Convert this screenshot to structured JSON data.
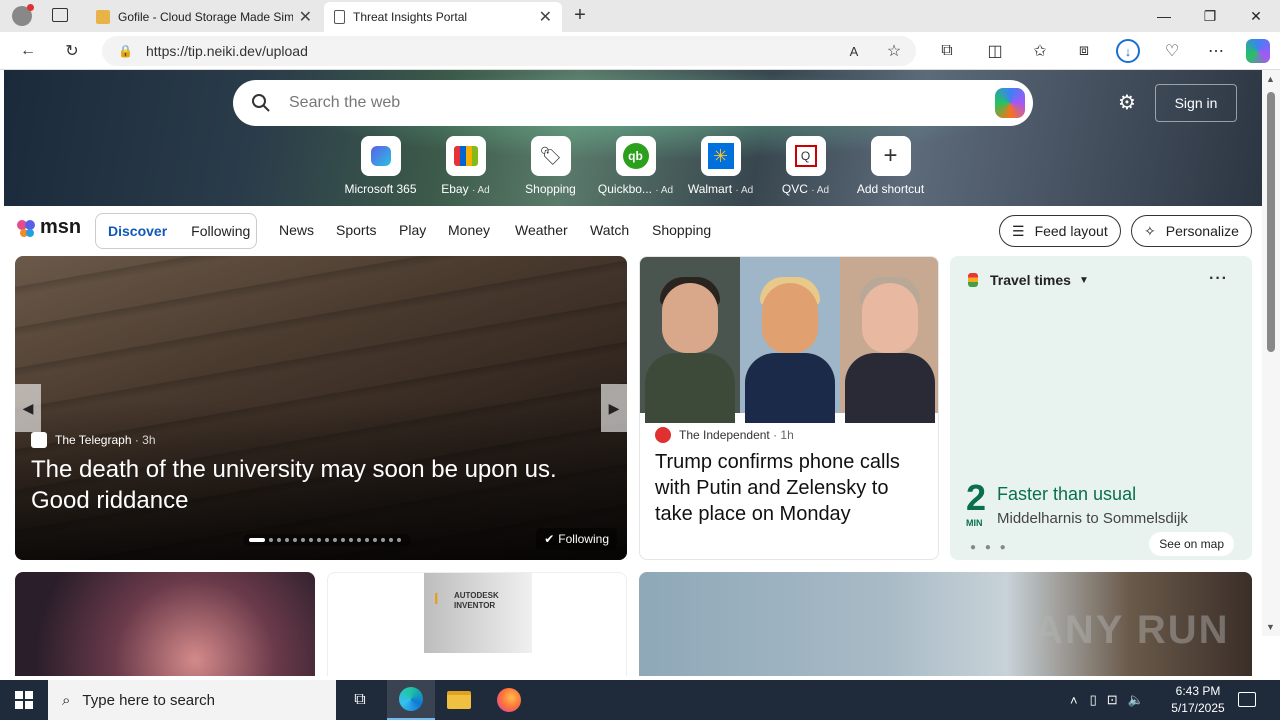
{
  "browser": {
    "tabs": [
      {
        "title": "Gofile - Cloud Storage Made Sim",
        "active": false
      },
      {
        "title": "Threat Insights Portal",
        "active": true
      }
    ],
    "url": "https://tip.neiki.dev/upload"
  },
  "header": {
    "search_placeholder": "Search the web",
    "signin_label": "Sign in"
  },
  "shortcuts": [
    {
      "label": "Microsoft 365",
      "ad": "",
      "icon": "microsoft365-icon"
    },
    {
      "label": "Ebay",
      "ad": "· Ad",
      "icon": "ebay-icon"
    },
    {
      "label": "Shopping",
      "ad": "",
      "icon": "shopping-tag-icon"
    },
    {
      "label": "Quickbo...",
      "ad": "· Ad",
      "icon": "quickbooks-icon"
    },
    {
      "label": "Walmart",
      "ad": "· Ad",
      "icon": "walmart-icon"
    },
    {
      "label": "QVC",
      "ad": "· Ad",
      "icon": "qvc-icon"
    },
    {
      "label": "Add shortcut",
      "ad": "",
      "icon": "plus-icon"
    }
  ],
  "nav": {
    "logo": "msn",
    "segments": [
      "Discover",
      "Following"
    ],
    "links": [
      "News",
      "Sports",
      "Play",
      "Money",
      "Weather",
      "Watch",
      "Shopping"
    ],
    "feed_layout": "Feed layout",
    "personalize": "Personalize"
  },
  "main_story": {
    "source": "The Telegraph",
    "age": "· 3h",
    "headline": "The death of the university may soon be upon us. Good riddance",
    "following": "Following",
    "slide_count": 18,
    "current_slide": 1
  },
  "news_card": {
    "source": "The Independent",
    "age": "· 1h",
    "headline": "Trump confirms phone calls with Putin and Zelensky to take place on Monday"
  },
  "travel": {
    "title": "Travel times",
    "minutes": "2",
    "unit": "MIN",
    "status": "Faster than usual",
    "route": "Middelharnis to Sommelsdijk",
    "see_map": "See on map"
  },
  "inventor": {
    "brand": "AUTODESK",
    "product": "INVENTOR"
  },
  "watermark": "ANY RUN",
  "taskbar": {
    "search_placeholder": "Type here to search",
    "time": "6:43 PM",
    "date": "5/17/2025"
  },
  "colors": {
    "msn_accent": "#0f5ab8",
    "travel_green": "#0b6e4f",
    "taskbar": "#1f2a3a"
  }
}
